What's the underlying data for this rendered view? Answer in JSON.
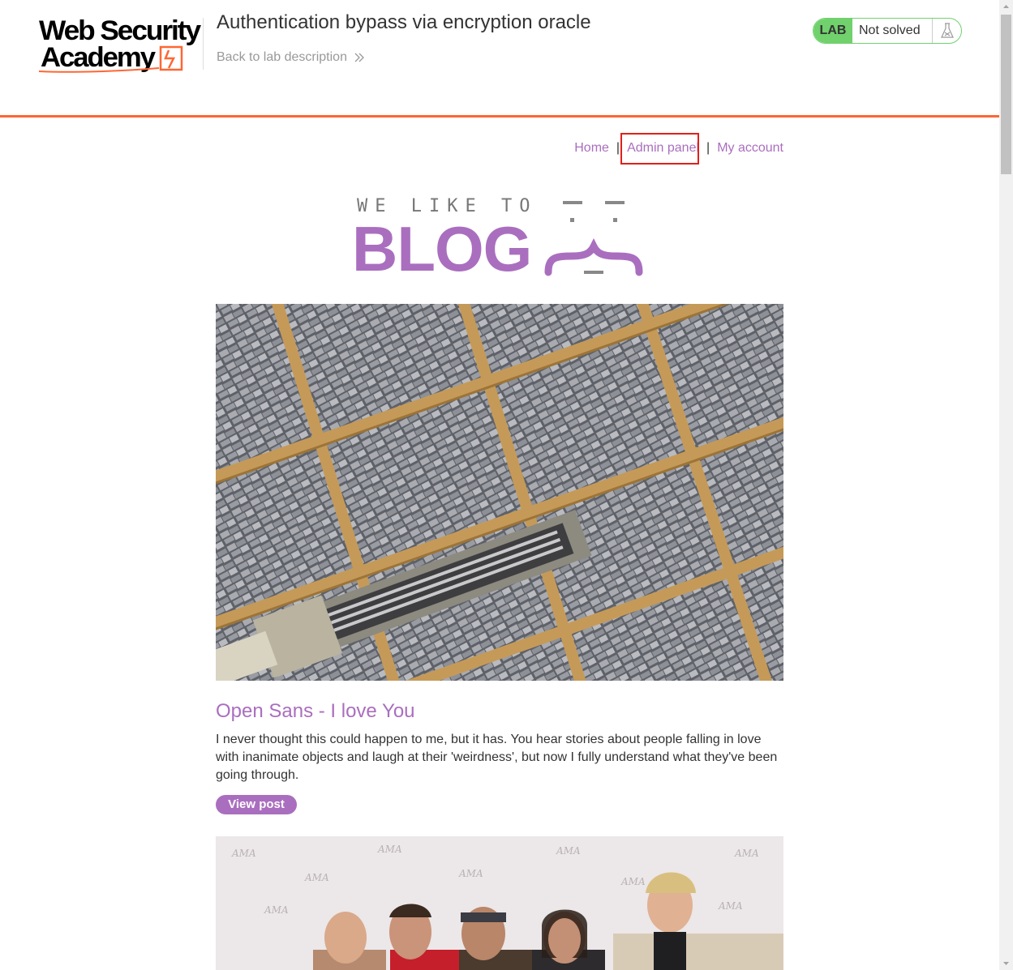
{
  "header": {
    "logo_text": [
      "Web Security",
      "Academy"
    ],
    "lab_title": "Authentication bypass via encryption oracle",
    "back_link": "Back to lab description",
    "lab_badge": "LAB",
    "lab_status": "Not solved"
  },
  "nav": {
    "home": "Home",
    "separator": "|",
    "admin": "Admin panel",
    "account": "My account"
  },
  "banner": {
    "tagline": "WE LIKE TO",
    "word": "BLOG"
  },
  "posts": [
    {
      "title": "Open Sans - I love You",
      "summary": "I never thought this could happen to me, but it has. You hear stories about people falling in love with inanimate objects and laugh at their 'weirdness', but now I fully understand what they've been going through.",
      "button": "View post"
    }
  ],
  "colors": {
    "accent_orange": "#ff6633",
    "blog_purple": "#aa6ebf",
    "lab_green": "#70d16d",
    "highlight_red": "#e0201a"
  },
  "icons": {
    "back": "double-chevron-right-icon",
    "flask": "flask-icon"
  }
}
